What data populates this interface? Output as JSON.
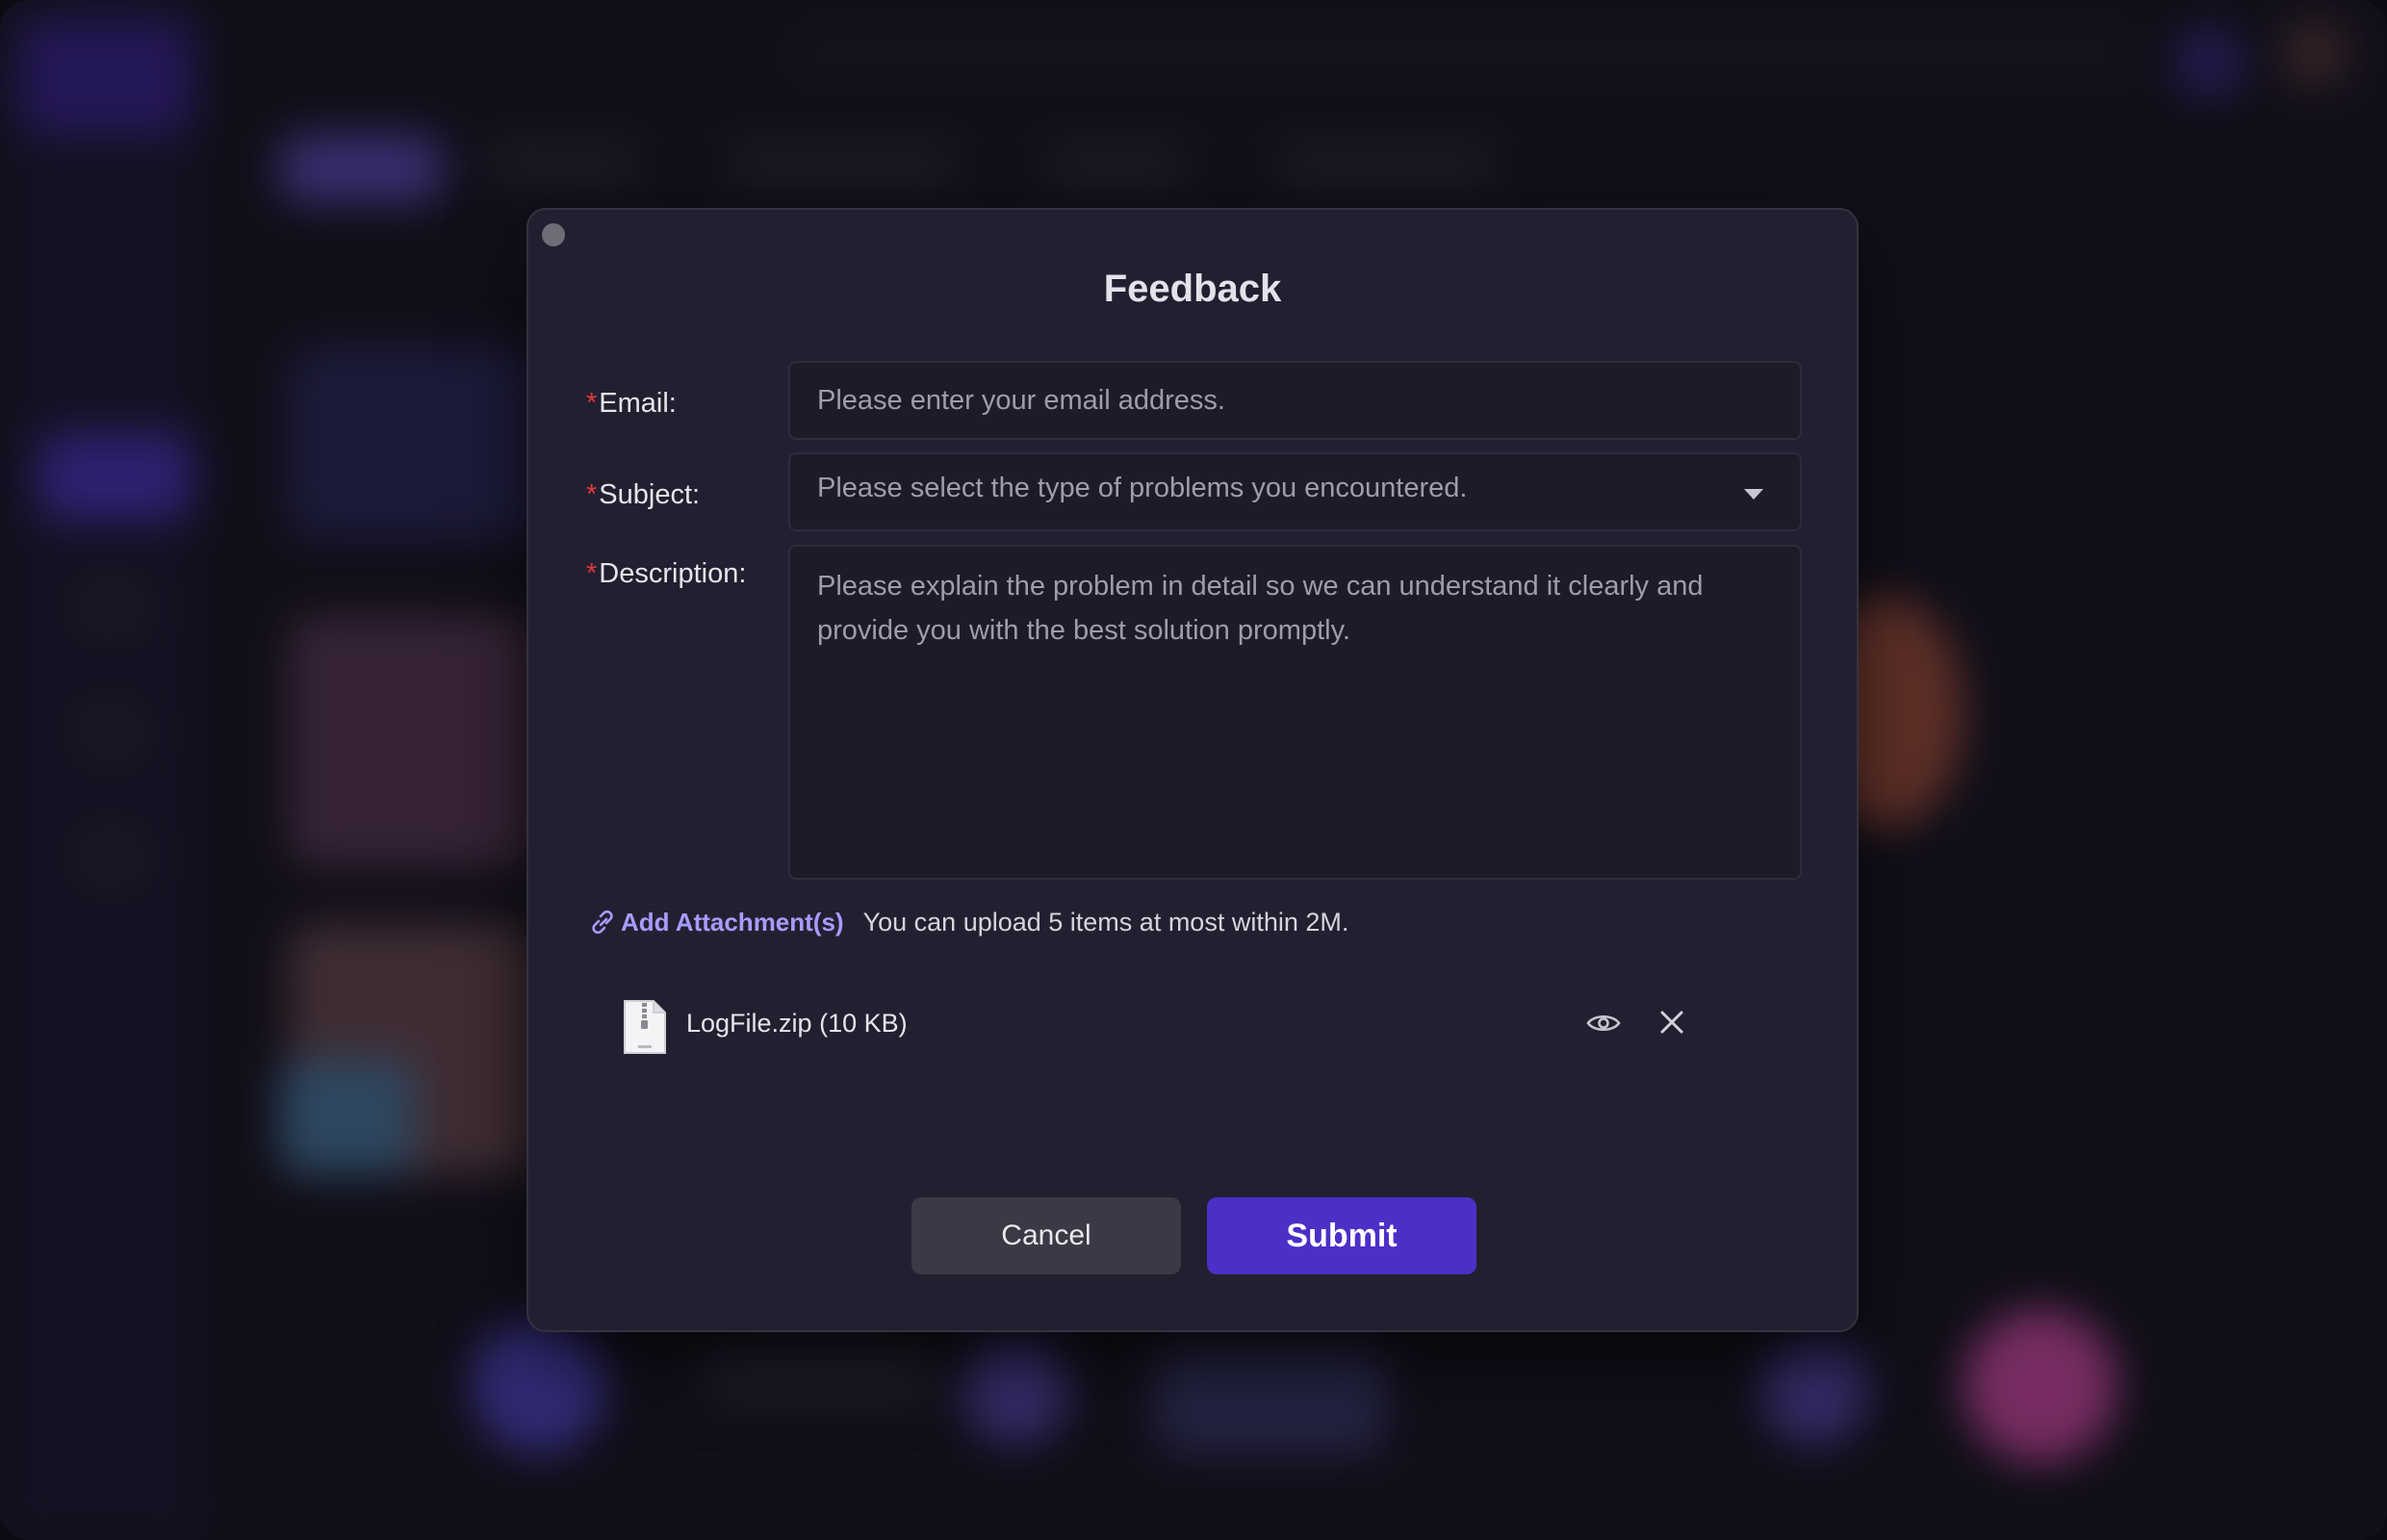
{
  "dialog": {
    "title": "Feedback",
    "required_mark": "*",
    "email": {
      "label": "Email:",
      "placeholder": "Please enter your email address."
    },
    "subject": {
      "label": "Subject:",
      "placeholder": "Please select the type of problems you encountered."
    },
    "description": {
      "label": "Description:",
      "placeholder": "Please explain the problem in detail so we can understand it clearly and provide you with the best solution promptly."
    },
    "attachment": {
      "link_label": "Add Attachment(s)",
      "hint": "You can upload 5 items at most within 2M.",
      "files": [
        {
          "name": "LogFile.zip (10 KB)",
          "icon": "zip-file-icon"
        }
      ]
    },
    "buttons": {
      "cancel": "Cancel",
      "submit": "Submit"
    }
  },
  "colors": {
    "accent": "#4c2fc6",
    "link": "#a89bff",
    "required": "#e0393e",
    "dialog_bg": "#222030"
  }
}
